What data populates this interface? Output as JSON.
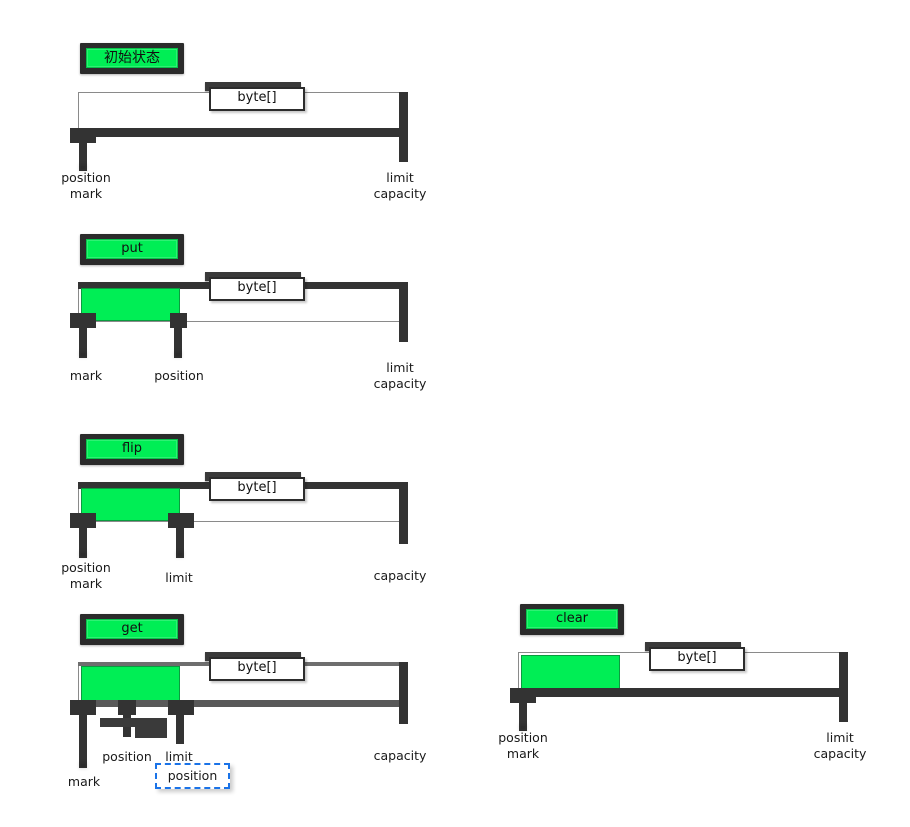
{
  "meta": {
    "byte_array_label": "byte[]",
    "accent_green": "#00ee55",
    "dark": "#333333",
    "drag_blue": "#1a73e8"
  },
  "panels": [
    {
      "id": "initial",
      "button_label": "初始状态",
      "array_label": "byte[]",
      "labels": {
        "left_top": "position",
        "left_bottom": "mark",
        "right_top": "limit",
        "right_bottom": "capacity"
      },
      "fill_percent": 0,
      "markers": [
        "position/mark at 0",
        "limit/capacity at end"
      ]
    },
    {
      "id": "put",
      "button_label": "put",
      "array_label": "byte[]",
      "labels": {
        "mark": "mark",
        "position": "position",
        "right_top": "limit",
        "right_bottom": "capacity"
      },
      "fill_percent": 30,
      "markers": [
        "mark at 0",
        "position after written bytes",
        "limit/capacity at end"
      ]
    },
    {
      "id": "flip",
      "button_label": "flip",
      "array_label": "byte[]",
      "labels": {
        "left_top": "position",
        "left_bottom": "mark",
        "limit": "limit",
        "capacity": "capacity"
      },
      "fill_percent": 30,
      "markers": [
        "position/mark at 0",
        "limit at written end",
        "capacity at end"
      ]
    },
    {
      "id": "get",
      "button_label": "get",
      "array_label": "byte[]",
      "labels": {
        "mark": "mark",
        "position": "position",
        "limit": "limit",
        "capacity": "capacity",
        "drag_ghost": "position"
      },
      "fill_percent": 30,
      "markers": [
        "mark at 0",
        "position being dragged",
        "limit at written end",
        "capacity at end"
      ]
    },
    {
      "id": "clear",
      "button_label": "clear",
      "array_label": "byte[]",
      "labels": {
        "left_top": "position",
        "left_bottom": "mark",
        "right_top": "limit",
        "right_bottom": "capacity"
      },
      "fill_percent": 30,
      "markers": [
        "position/mark at 0",
        "limit/capacity at end"
      ]
    }
  ]
}
